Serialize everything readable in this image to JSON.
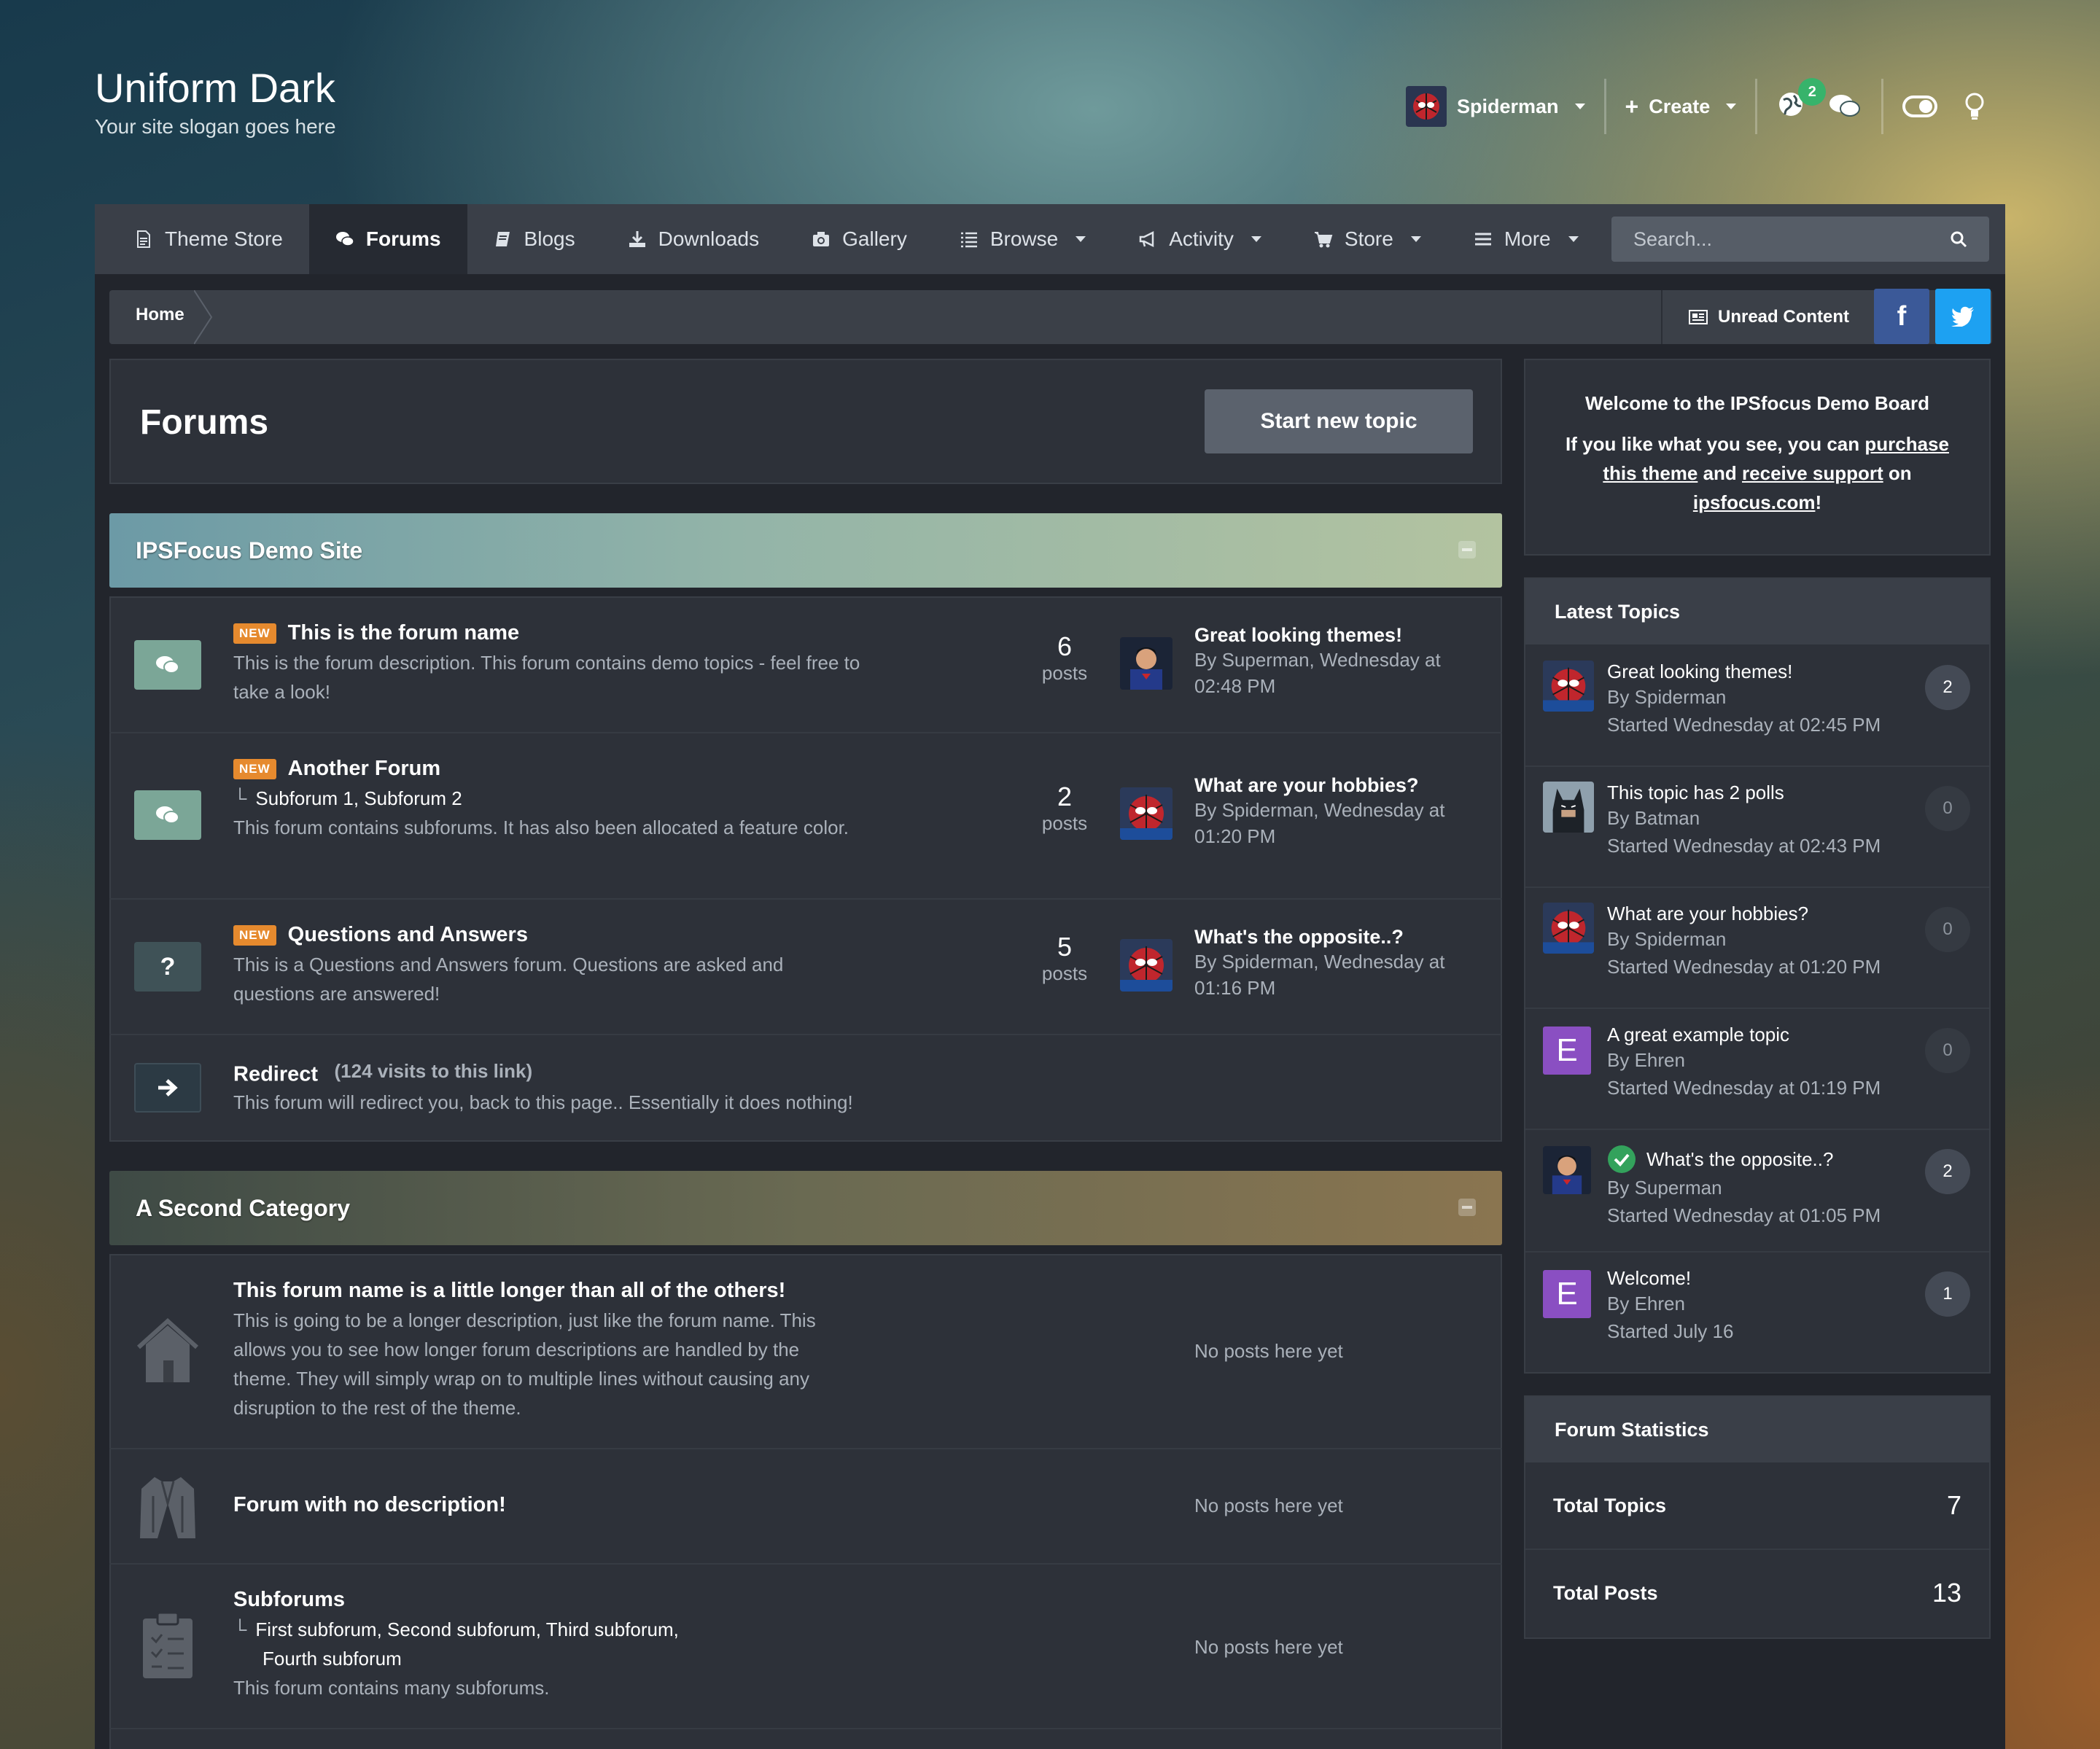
{
  "site": {
    "title": "Uniform Dark",
    "slogan": "Your site slogan goes here"
  },
  "header": {
    "user": "Spiderman",
    "create": "Create",
    "notifications_count": "2"
  },
  "nav": {
    "tabs": [
      {
        "label": "Theme Store",
        "icon": "document-icon"
      },
      {
        "label": "Forums",
        "icon": "chat-bubbles-icon",
        "active": true
      },
      {
        "label": "Blogs",
        "icon": "book-icon"
      },
      {
        "label": "Downloads",
        "icon": "download-icon"
      },
      {
        "label": "Gallery",
        "icon": "camera-icon"
      },
      {
        "label": "Browse",
        "icon": "list-icon",
        "dropdown": true
      },
      {
        "label": "Activity",
        "icon": "megaphone-icon",
        "dropdown": true
      },
      {
        "label": "Store",
        "icon": "cart-icon",
        "dropdown": true
      },
      {
        "label": "More",
        "icon": "menu-icon",
        "dropdown": true
      }
    ],
    "search_placeholder": "Search..."
  },
  "breadcrumb": {
    "home": "Home",
    "unread": "Unread Content"
  },
  "social": {
    "facebook": "f",
    "twitter_color": "#1da1f2",
    "facebook_color": "#3b5998"
  },
  "page": {
    "title": "Forums",
    "new_topic": "Start new topic"
  },
  "categories": [
    {
      "name": "IPSFocus Demo Site",
      "forums": [
        {
          "new": "NEW",
          "name": "This is the forum name",
          "desc": "This is the forum description. This forum contains demo topics - feel free to take a look!",
          "count": "6",
          "count_label": "posts",
          "last_title": "Great looking themes!",
          "last_meta": "By Superman, Wednesday at 02:48 PM"
        },
        {
          "new": "NEW",
          "name": "Another Forum",
          "subforums": "Subforum 1,  Subforum 2",
          "desc": "This forum contains subforums. It has also been allocated a feature color.",
          "count": "2",
          "count_label": "posts",
          "last_title": "What are your hobbies?",
          "last_meta": "By Spiderman, Wednesday at 01:20 PM"
        },
        {
          "new": "NEW",
          "name": "Questions and Answers",
          "desc": "This is a Questions and Answers forum. Questions are asked and questions are answered!",
          "count": "5",
          "count_label": "posts",
          "last_title": "What's the opposite..?",
          "last_meta": "By Spiderman, Wednesday at 01:16 PM"
        },
        {
          "name": "Redirect",
          "redirect_info": "(124 visits to this link)",
          "desc": "This forum will redirect you, back to this page.. Essentially it does nothing!"
        }
      ]
    },
    {
      "name": "A Second Category",
      "forums": [
        {
          "name": "This forum name is a little longer than all of the others!",
          "desc": "This is going to be a longer description, just like the forum name. This allows you to see how longer forum descriptions are handled by the theme. They will simply wrap on to multiple lines without causing any disruption to the rest of the theme.",
          "empty": "No posts here yet"
        },
        {
          "name": "Forum with no description!",
          "empty": "No posts here yet"
        },
        {
          "name": "Subforums",
          "subforums_line1": "First subforum,  Second subforum,  Third subforum,",
          "subforums_line2": "Fourth subforum",
          "desc": "This forum contains many subforums.",
          "empty": "No posts here yet"
        }
      ]
    }
  ],
  "sidebar": {
    "welcome": {
      "title": "Welcome to the IPSfocus Demo Board",
      "line_a": "If you like what you see, you can ",
      "link1": "purchase",
      "link1b": "this theme",
      "mid": " and ",
      "link2": "receive support",
      "after": " on",
      "link3": "ipsfocus.com",
      "end": "!"
    },
    "latest": {
      "title": "Latest Topics",
      "items": [
        {
          "title": "Great looking themes!",
          "by": "By Spiderman",
          "started": "Started Wednesday at 02:45 PM",
          "count": "2"
        },
        {
          "title": "This topic has 2 polls",
          "by": "By Batman",
          "started": "Started Wednesday at 02:43 PM",
          "count": "0"
        },
        {
          "title": "What are your hobbies?",
          "by": "By Spiderman",
          "started": "Started Wednesday at 01:20 PM",
          "count": "0"
        },
        {
          "title": "A great example topic",
          "by": "By Ehren",
          "started": "Started Wednesday at 01:19 PM",
          "count": "0",
          "letter": "E"
        },
        {
          "title": "What's the opposite..?",
          "by": "By Superman",
          "started": "Started Wednesday at 01:05 PM",
          "count": "2",
          "solved": true
        },
        {
          "title": "Welcome!",
          "by": "By Ehren",
          "started": "Started July 16",
          "count": "1",
          "letter": "E"
        }
      ]
    },
    "stats": {
      "title": "Forum Statistics",
      "rows": [
        {
          "label": "Total Topics",
          "value": "7"
        },
        {
          "label": "Total Posts",
          "value": "13"
        }
      ]
    }
  }
}
